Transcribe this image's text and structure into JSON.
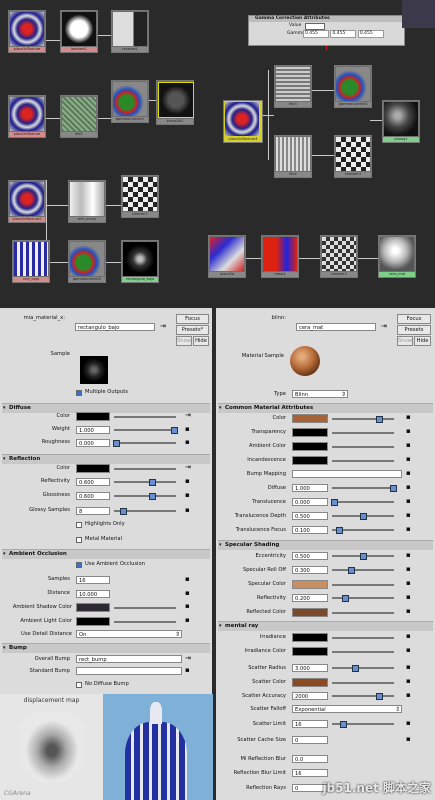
{
  "graph": {
    "nodes": [
      {
        "id": "n1",
        "label": "place2dTexture",
        "color": "pink"
      },
      {
        "id": "n2",
        "label": "lambert1",
        "color": "pink"
      },
      {
        "id": "n3",
        "label": "reverse1",
        "color": "grey"
      },
      {
        "id": "n4",
        "label": "file1",
        "color": "grey"
      },
      {
        "id": "n5",
        "label": "gammaCorrect1",
        "color": "grey"
      },
      {
        "id": "n6",
        "label": "bump2d1",
        "color": "green"
      },
      {
        "id": "n7",
        "label": "place2dTexture",
        "color": "pink"
      },
      {
        "id": "n8",
        "label": "file2",
        "color": "grey"
      },
      {
        "id": "n9",
        "label": "gammaCorrect2",
        "color": "grey"
      },
      {
        "id": "n10",
        "label": "blinn1",
        "color": "green"
      },
      {
        "id": "n11",
        "label": "place2dTexture2",
        "color": "grey"
      },
      {
        "id": "n12",
        "label": "rect_bump",
        "color": "grey"
      },
      {
        "id": "n13",
        "label": "checker1",
        "color": "grey"
      },
      {
        "id": "n14",
        "label": "rect_bajo",
        "color": "pink"
      },
      {
        "id": "n15",
        "label": "gammaCorrect3",
        "color": "grey"
      },
      {
        "id": "n16",
        "label": "rectangulo_bajo",
        "color": "green"
      },
      {
        "id": "n17",
        "label": "place3d",
        "color": "grey"
      },
      {
        "id": "n18",
        "label": "ramp1",
        "color": "grey"
      },
      {
        "id": "n19",
        "label": "checker2",
        "color": "grey"
      },
      {
        "id": "n20",
        "label": "cera_mat",
        "color": "green"
      },
      {
        "id": "n21",
        "label": "place2dTexture4",
        "color": "grey"
      },
      {
        "id": "n22",
        "label": "file3",
        "color": "grey"
      },
      {
        "id": "n23",
        "label": "file4",
        "color": "grey"
      },
      {
        "id": "n24",
        "label": "gammaCorrect4",
        "color": "grey"
      },
      {
        "id": "n25",
        "label": "checker3",
        "color": "grey"
      },
      {
        "id": "n26",
        "label": "phong1",
        "color": "green"
      }
    ],
    "gamma_popup": {
      "title": "Gamma Correction Attributes",
      "value_label": "Value",
      "gamma_label": "Gamma",
      "gamma_values": [
        "0.455",
        "0.455",
        "0.455"
      ]
    }
  },
  "left": {
    "type_label": "mia_material_x:",
    "name_value": "rectangulo_bajo",
    "focus_label": "Focus",
    "presets_label": "Presets*",
    "show_label": "Show",
    "hide_label": "Hide",
    "sample_label": "Sample",
    "multiple_outputs": "Multiple Outputs",
    "diffuse": {
      "title": "Diffuse",
      "color_label": "Color",
      "weight_label": "Weight",
      "weight": "1.000",
      "roughness_label": "Roughness",
      "roughness": "0.000"
    },
    "reflection": {
      "title": "Reflection",
      "color_label": "Color",
      "reflectivity_label": "Reflectivity",
      "reflectivity": "0.600",
      "glossiness_label": "Glossiness",
      "glossiness": "0.600",
      "glossy_samples_label": "Glossy Samples",
      "glossy_samples": "8",
      "highlights_only": "Highlights Only",
      "metal_material": "Metal Material"
    },
    "ao": {
      "title": "Ambient Occlusion",
      "use_ao": "Use Ambient Occlusion",
      "samples_label": "Samples",
      "samples": "16",
      "distance_label": "Distance",
      "distance": "10.000",
      "shadow_color_label": "Ambient Shadow Color",
      "light_color_label": "Ambient Light Color",
      "detail_label": "Use Detail Distance",
      "detail_value": "On"
    },
    "bump": {
      "title": "Bump",
      "overall_label": "Overall Bump",
      "overall_value": "rect_bump",
      "standard_label": "Standard Bump",
      "no_diffuse": "No Diffuse Bump"
    },
    "displacement_caption": "displacement map",
    "credit": "CGArena"
  },
  "right": {
    "type_label": "blinn:",
    "name_value": "cera_mat",
    "focus_label": "Focus",
    "presets_label": "Presets",
    "show_label": "Show",
    "hide_label": "Hide",
    "sample_label": "Material Sample",
    "type_field_label": "Type",
    "type_value": "Blinn",
    "common": {
      "title": "Common Material Attributes",
      "color": "Color",
      "transparency": "Transparency",
      "ambient": "Ambient Color",
      "incandescence": "Incandescence",
      "bump": "Bump Mapping",
      "diffuse_label": "Diffuse",
      "diffuse": "1.000",
      "translucence_label": "Translucence",
      "translucence": "0.000",
      "depth_label": "Translucence Depth",
      "depth": "0.500",
      "focus_label": "Translucence Focus",
      "focus": "0.100"
    },
    "specular": {
      "title": "Specular Shading",
      "ecc_label": "Eccentricity",
      "ecc": "0.500",
      "rolloff_label": "Specular Roll Off",
      "rolloff": "0.300",
      "color_label": "Specular Color",
      "refl_label": "Reflectivity",
      "refl": "0.200",
      "refl_color_label": "Reflected Color"
    },
    "mray": {
      "title": "mental ray",
      "irradiance": "Irradiance",
      "irr_color": "Irradiance Color",
      "scatter_radius_label": "Scatter Radius",
      "scatter_radius": "3.000",
      "scatter_color": "Scatter Color",
      "accuracy_label": "Scatter Accuracy",
      "accuracy": "2000",
      "falloff_label": "Scatter Falloff",
      "falloff": "Exponential",
      "limit_label": "Scatter Limit",
      "limit": "16",
      "cache_label": "Scatter Cache Size",
      "cache": "0",
      "mi_refl_label": "Mi Reflection Blur",
      "mi_refl": "0.0",
      "refl_limit_label": "Reflection Blur Limit",
      "refl_limit": "16",
      "refl_rays_label": "Reflection Rays",
      "refl_rays": "0"
    },
    "watermark": "jb51.net 脚本之家"
  }
}
